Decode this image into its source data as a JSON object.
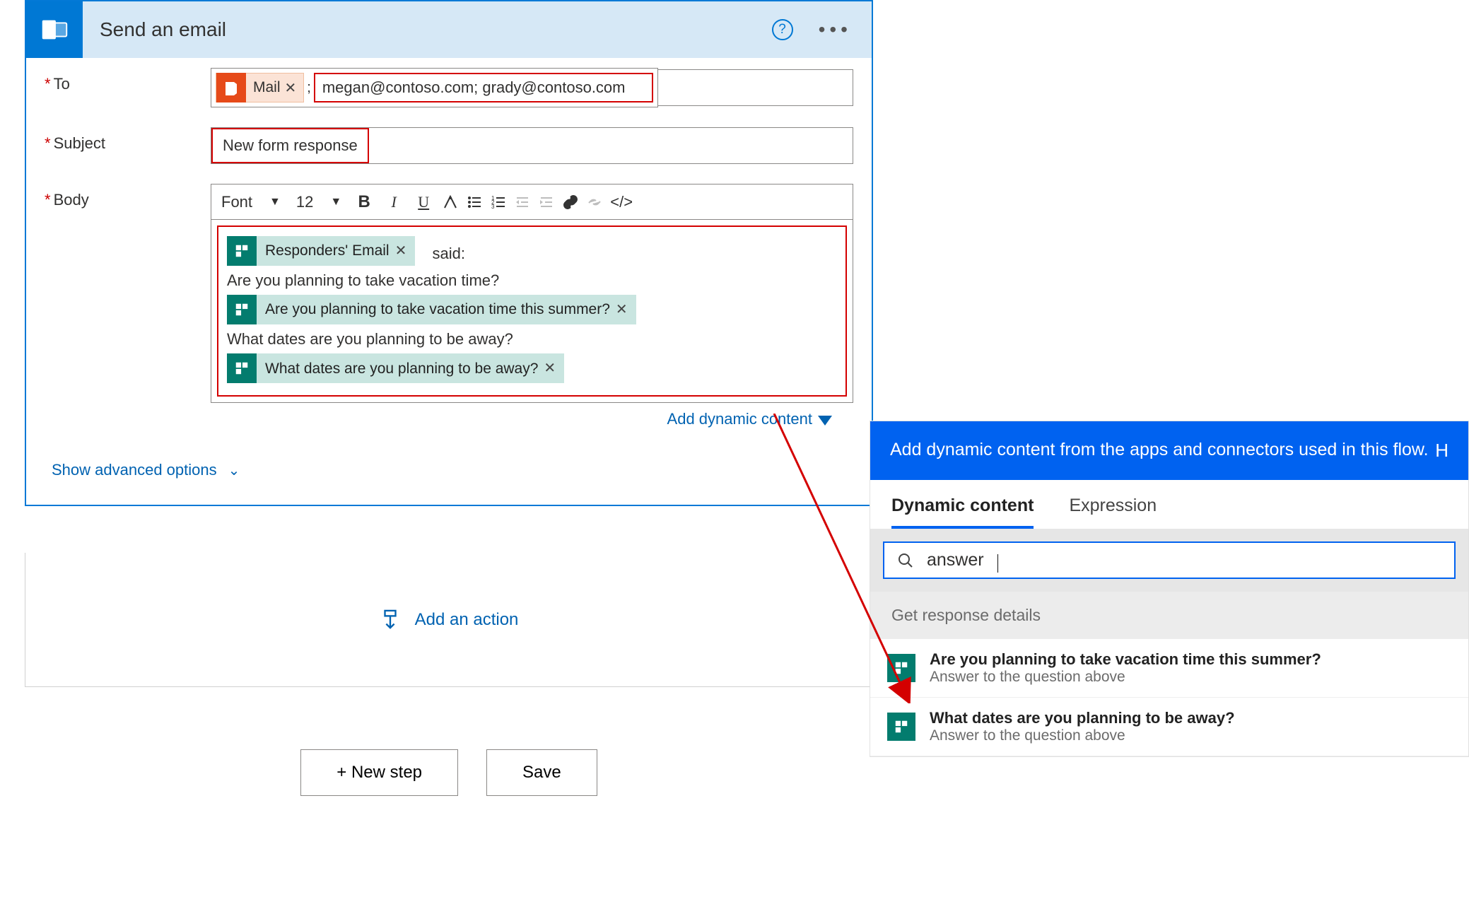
{
  "card": {
    "title": "Send an email",
    "fields": {
      "to_label": "To",
      "subject_label": "Subject",
      "body_label": "Body"
    },
    "to": {
      "token_label": "Mail",
      "emails": "megan@contoso.com; grady@contoso.com"
    },
    "subject": "New form response",
    "rte": {
      "font_label": "Font",
      "size_label": "12"
    },
    "body": {
      "token_responder": "Responders' Email",
      "said": "said:",
      "q1_text": "Are you planning to take vacation time?",
      "token_q1": "Are you planning to take vacation time this summer?",
      "q2_text": "What dates are you planning to be away?",
      "token_q2": "What dates are you planning to be away?"
    },
    "add_dynamic": "Add dynamic content",
    "adv_options": "Show advanced options"
  },
  "add_action": "Add an action",
  "buttons": {
    "new_step": "+ New step",
    "save": "Save"
  },
  "dc": {
    "header": "Add dynamic content from the apps and connectors used in this flow.",
    "header_link": "H",
    "tab_dynamic": "Dynamic content",
    "tab_expression": "Expression",
    "search_value": "answer",
    "group": "Get response details",
    "items": [
      {
        "title": "Are you planning to take vacation time this summer?",
        "sub": "Answer to the question above"
      },
      {
        "title": "What dates are you planning to be away?",
        "sub": "Answer to the question above"
      }
    ]
  }
}
